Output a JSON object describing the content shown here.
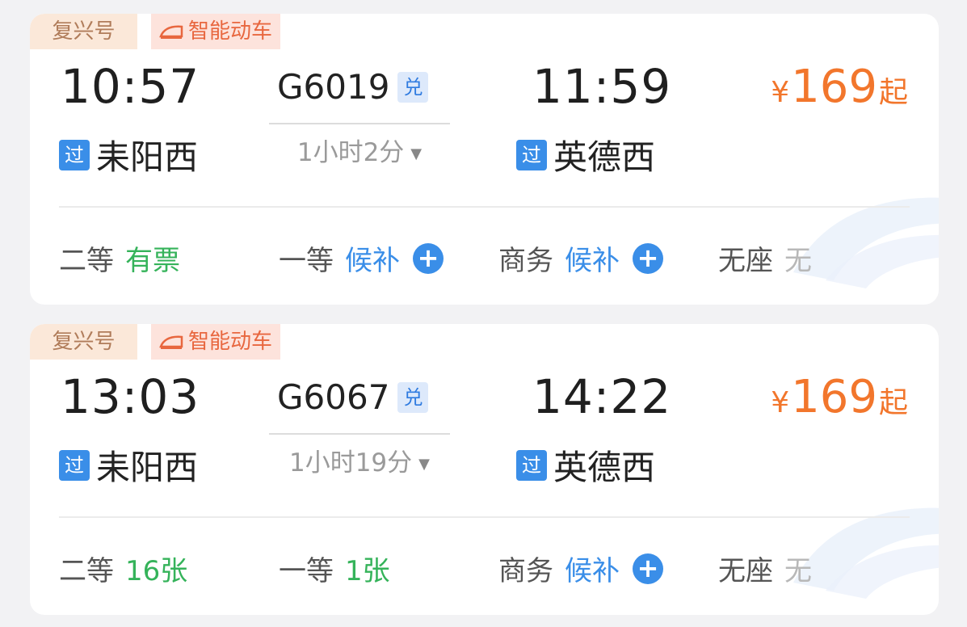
{
  "trains": [
    {
      "brand_tag": "复兴号",
      "smart_tag": "智能动车",
      "dep_time": "10:57",
      "train_no": "G6019",
      "exchange_badge": "兑",
      "duration": "1小时2分",
      "arr_time": "11:59",
      "pass_badge": "过",
      "dep_station": "耒阳西",
      "arr_station": "英德西",
      "price_currency": "¥",
      "price_value": "169",
      "price_suffix": "起",
      "seats": [
        {
          "name": "二等",
          "value": "有票"
        },
        {
          "name": "一等",
          "value": "候补"
        },
        {
          "name": "商务",
          "value": "候补"
        },
        {
          "name": "无座",
          "value": "无"
        }
      ]
    },
    {
      "brand_tag": "复兴号",
      "smart_tag": "智能动车",
      "dep_time": "13:03",
      "train_no": "G6067",
      "exchange_badge": "兑",
      "duration": "1小时19分",
      "arr_time": "14:22",
      "pass_badge": "过",
      "dep_station": "耒阳西",
      "arr_station": "英德西",
      "price_currency": "¥",
      "price_value": "169",
      "price_suffix": "起",
      "seats": [
        {
          "name": "二等",
          "value": "16张"
        },
        {
          "name": "一等",
          "value": "1张"
        },
        {
          "name": "商务",
          "value": "候补"
        },
        {
          "name": "无座",
          "value": "无"
        }
      ]
    }
  ],
  "colors": {
    "accent_orange": "#f2762c",
    "available_green": "#35b35a",
    "waitlist_blue": "#3a8ee8",
    "none_gray": "#b8b8b8"
  }
}
